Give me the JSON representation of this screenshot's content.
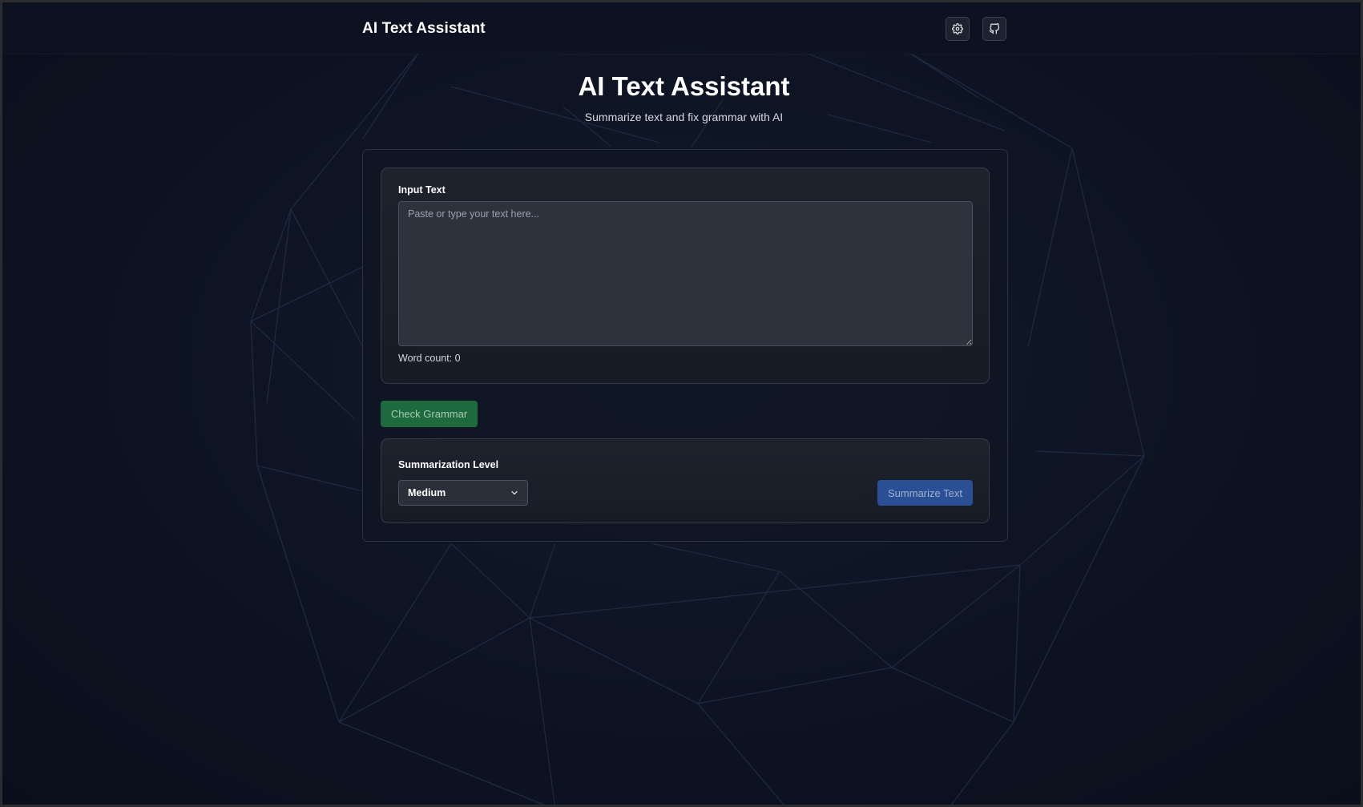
{
  "header": {
    "brand": "AI Text Assistant",
    "settings_icon": "gear-icon",
    "github_icon": "github-icon"
  },
  "hero": {
    "title": "AI Text Assistant",
    "subtitle": "Summarize text and fix grammar with AI"
  },
  "input": {
    "label": "Input Text",
    "placeholder": "Paste or type your text here...",
    "value": "",
    "word_count_text": "Word count: 0"
  },
  "actions": {
    "check_grammar_label": "Check Grammar"
  },
  "summarization": {
    "label": "Summarization Level",
    "selected_level": "Medium",
    "summarize_label": "Summarize Text"
  },
  "colors": {
    "background": "#0c1220",
    "grammar_button": "#1c6a3e",
    "summarize_button": "#2a4f95",
    "mesh_line": "#1f2c44"
  }
}
